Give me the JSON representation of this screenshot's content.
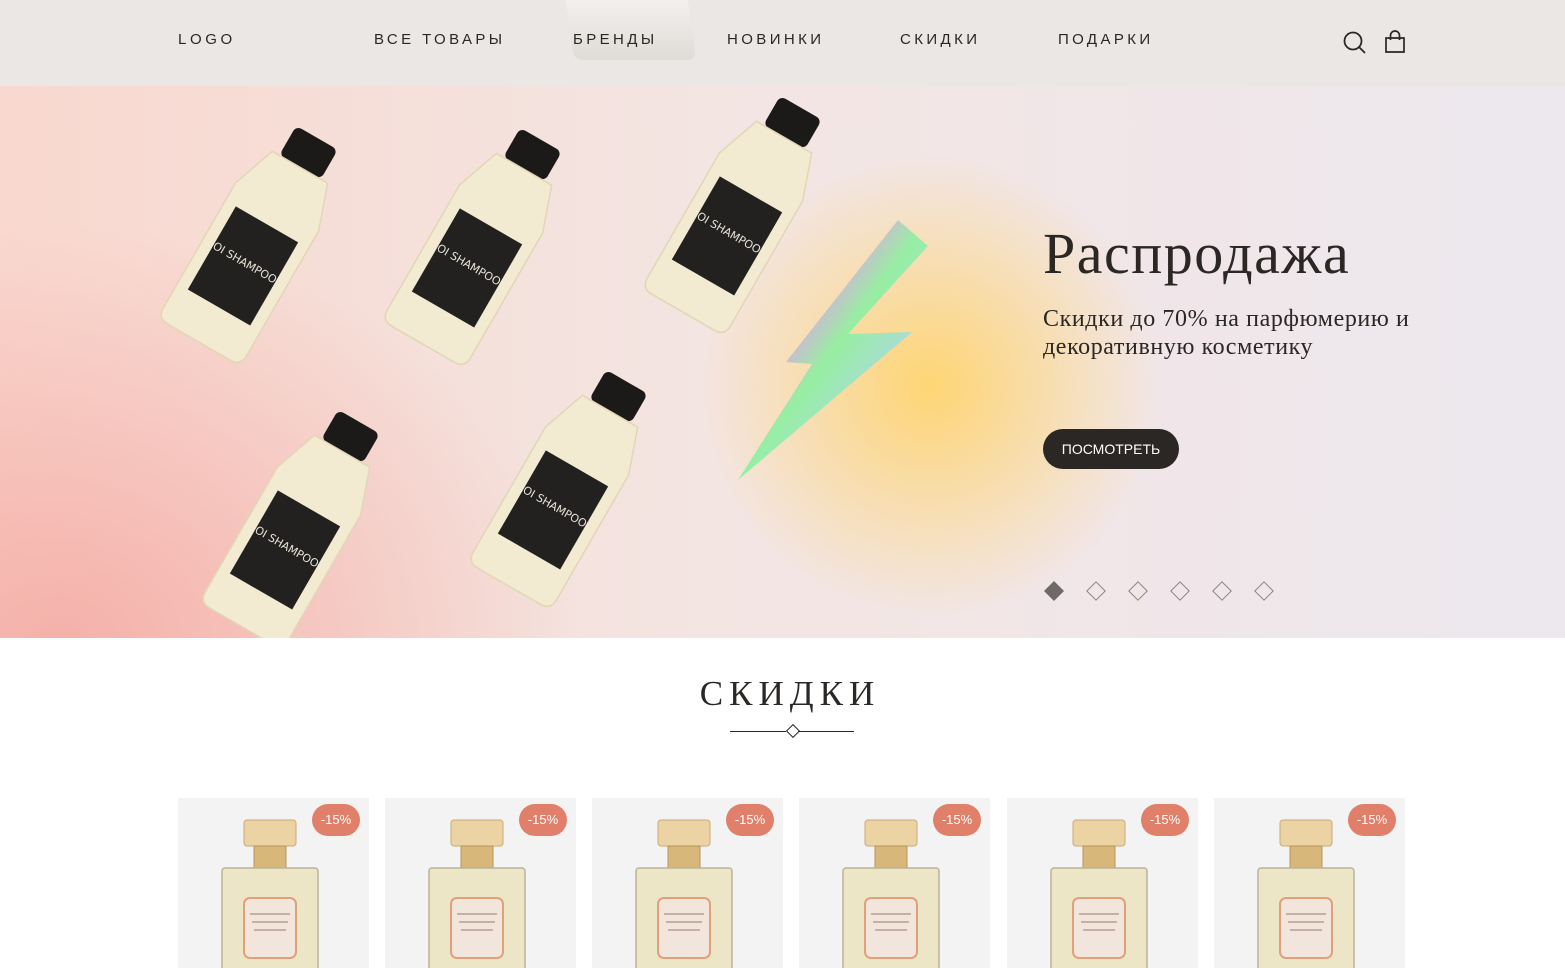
{
  "header": {
    "logo": "LOGO",
    "nav": [
      "ВСЕ ТОВАРЫ",
      "БРЕНДЫ",
      "НОВИНКИ",
      "СКИДКИ",
      "ПОДАРКИ"
    ],
    "icons": [
      "search-icon",
      "shopping-bag-icon"
    ]
  },
  "hero": {
    "title": "Распродажа",
    "subtitle": "Скидки до 70% на парфюмерию и декоративную косметику",
    "button": "ПОСМОТРЕТЬ",
    "bottle_label": "OI SHAMPOO",
    "slides_total": 6,
    "active_slide": 1
  },
  "discounts": {
    "title": "СКИДКИ",
    "products": [
      {
        "badge": "-15%"
      },
      {
        "badge": "-15%"
      },
      {
        "badge": "-15%"
      },
      {
        "badge": "-15%"
      },
      {
        "badge": "-15%"
      },
      {
        "badge": "-15%"
      }
    ]
  },
  "colors": {
    "text": "#2a2724",
    "header_bg": "#ebe7e4",
    "badge": "#e07f6a",
    "button": "#2a2724",
    "card_bg": "#f3f3f3"
  }
}
